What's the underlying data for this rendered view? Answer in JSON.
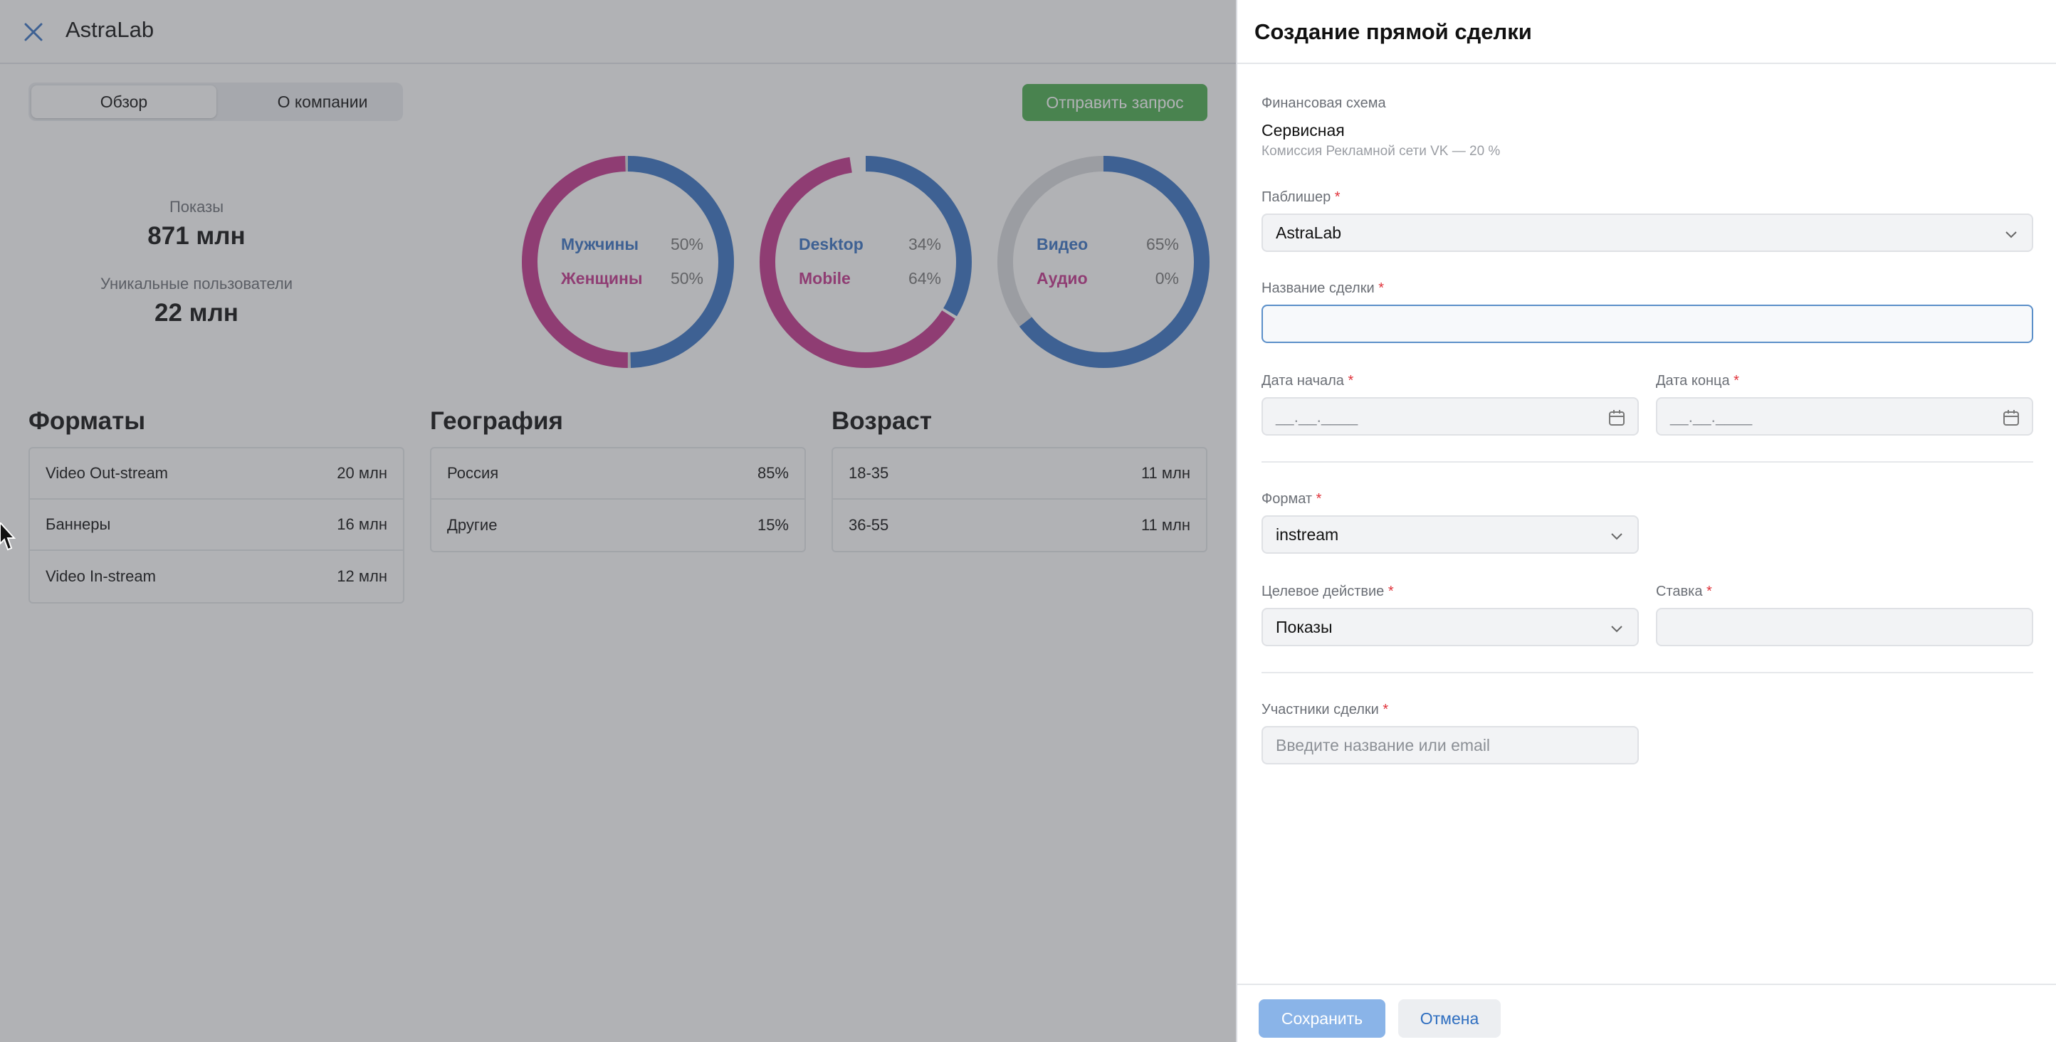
{
  "app": {
    "title": "AstraLab"
  },
  "tabs": [
    {
      "label": "Обзор"
    },
    {
      "label": "О компании"
    }
  ],
  "actions": {
    "send_request": "Отправить запрос"
  },
  "stats": {
    "impressions_label": "Показы",
    "impressions_value": "871 млн",
    "unique_users_label": "Уникальные пользователи",
    "unique_users_value": "22 млн"
  },
  "colors": {
    "blue": "#3a74c4",
    "pink": "#c5368d",
    "gray": "#d9dbde",
    "accent_green": "#4caf50"
  },
  "chart_data": [
    {
      "type": "pie",
      "labels": [
        "Мужчины",
        "Женщины"
      ],
      "display": [
        "50%",
        "50%"
      ],
      "values": [
        50,
        50
      ]
    },
    {
      "type": "pie",
      "labels": [
        "Desktop",
        "Mobile"
      ],
      "display": [
        "34%",
        "64%"
      ],
      "values": [
        34,
        64
      ]
    },
    {
      "type": "pie",
      "labels": [
        "Видео",
        "Аудио"
      ],
      "display": [
        "65%",
        "0%"
      ],
      "values": [
        65,
        0
      ]
    }
  ],
  "sections": {
    "formats": {
      "title": "Форматы",
      "rows": [
        {
          "label": "Video Out-stream",
          "value": "20 млн"
        },
        {
          "label": "Баннеры",
          "value": "16 млн"
        },
        {
          "label": "Video In-stream",
          "value": "12 млн"
        }
      ]
    },
    "geography": {
      "title": "География",
      "rows": [
        {
          "label": "Россия",
          "value": "85%"
        },
        {
          "label": "Другие",
          "value": "15%"
        }
      ]
    },
    "age": {
      "title": "Возраст",
      "rows": [
        {
          "label": "18-35",
          "value": "11 млн"
        },
        {
          "label": "36-55",
          "value": "11 млн"
        }
      ]
    }
  },
  "panel": {
    "title": "Создание прямой сделки",
    "finance_label": "Финансовая схема",
    "finance_value": "Сервисная",
    "finance_note": "Комиссия Рекламной сети VK — 20 %",
    "publisher_label": "Паблишер",
    "publisher_value": "AstraLab",
    "deal_name_label": "Название сделки",
    "deal_name_value": "",
    "start_date_label": "Дата начала",
    "start_date_placeholder": "__.__.____",
    "end_date_label": "Дата конца",
    "end_date_placeholder": "__.__.____",
    "format_label": "Формат",
    "format_value": "instream",
    "target_action_label": "Целевое действие",
    "target_action_value": "Показы",
    "rate_label": "Ставка",
    "rate_value": "",
    "participants_label": "Участники сделки",
    "participants_placeholder": "Введите название или email",
    "required_mark": "*",
    "save": "Сохранить",
    "cancel": "Отмена"
  }
}
